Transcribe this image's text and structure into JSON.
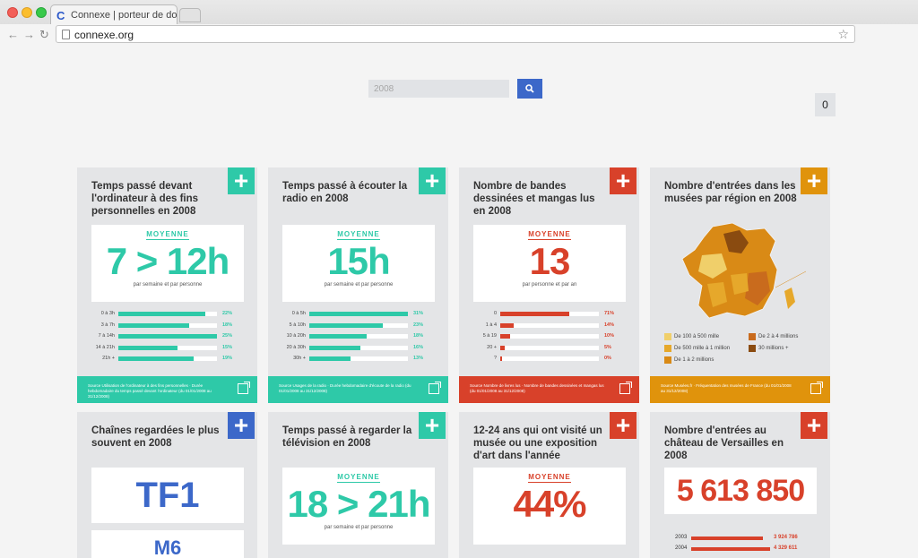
{
  "browser": {
    "tab_title": "Connexe | porteur de don",
    "tab_icon": "C",
    "url": "connexe.org"
  },
  "search": {
    "value": "2008"
  },
  "counter": "0",
  "colors": {
    "teal": "#2ec9a8",
    "red": "#d8412a",
    "blue": "#3c68c9",
    "orange": "#e0930c"
  },
  "cards": {
    "computer": {
      "title": "Temps passé devant l'ordinateur à des fins personnelles en 2008",
      "moyenne": "MOYENNE",
      "big": "7 > 12h",
      "unit": "par semaine et par personne",
      "rows": [
        {
          "label": "0 à 3h",
          "pct": "22%",
          "value": 22
        },
        {
          "label": "3 à 7h",
          "pct": "18%",
          "value": 18
        },
        {
          "label": "7 à 14h",
          "pct": "25%",
          "value": 25
        },
        {
          "label": "14 à 21h",
          "pct": "15%",
          "value": 15
        },
        {
          "label": "21h +",
          "pct": "19%",
          "value": 19
        }
      ],
      "source": "Source Utilisation de l'ordinateur à des fins personnelles · Durée hebdomadaire du temps passé devant l'ordinateur (du 01/01/2008 au 31/12/2008)"
    },
    "radio": {
      "title": "Temps passé à écouter la radio en 2008",
      "moyenne": "MOYENNE",
      "big": "15h",
      "unit": "par semaine et par personne",
      "rows": [
        {
          "label": "0 à 5h",
          "pct": "31%",
          "value": 31
        },
        {
          "label": "5 à 10h",
          "pct": "23%",
          "value": 23
        },
        {
          "label": "10 à 20h",
          "pct": "18%",
          "value": 18
        },
        {
          "label": "20 à 30h",
          "pct": "16%",
          "value": 16
        },
        {
          "label": "30h +",
          "pct": "13%",
          "value": 13
        }
      ],
      "source": "Source Usages de la radio · Durée hebdomadaire d'écoute de la radio (du 01/01/2008 au 31/12/2008)"
    },
    "bd": {
      "title": "Nombre de bandes dessinées et mangas lus en 2008",
      "moyenne": "MOYENNE",
      "big": "13",
      "unit": "par personne et par an",
      "rows": [
        {
          "label": "0",
          "pct": "71%",
          "value": 71
        },
        {
          "label": "1 à 4",
          "pct": "14%",
          "value": 14
        },
        {
          "label": "5 à 19",
          "pct": "10%",
          "value": 10
        },
        {
          "label": "20 +",
          "pct": "5%",
          "value": 5
        },
        {
          "label": "?",
          "pct": "0%",
          "value": 0
        }
      ],
      "source": "Source Nombre de livres lus · Nombre de bandes dessinées et mangas lus (du 01/01/2008 au 31/12/2008)"
    },
    "museums": {
      "title": "Nombre d'entrées dans les musées par région en 2008",
      "legend": [
        {
          "label": "De 100 à 500 mille",
          "color": "#f0cf6a"
        },
        {
          "label": "De 2 à 4 millions",
          "color": "#c96b1d"
        },
        {
          "label": "De 500 mille à 1 million",
          "color": "#e6a82b"
        },
        {
          "label": "30 millions +",
          "color": "#8a4b10"
        },
        {
          "label": "De 1 à 2 millions",
          "color": "#d98a16"
        }
      ],
      "source": "Source Musées.fr · Fréquentation des musées de France (du 01/01/2008 au 31/12/2008)"
    },
    "channels": {
      "title": "Chaînes regardées le plus souvent en 2008",
      "first": "TF1",
      "second": "M6"
    },
    "tv": {
      "title": "Temps passé à regarder la télévision en 2008",
      "moyenne": "MOYENNE",
      "big": "18 > 21h",
      "unit": "par semaine et par personne"
    },
    "youth": {
      "title": "12-24 ans qui ont visité un musée ou une exposition d'art dans l'année",
      "moyenne": "MOYENNE",
      "big": "44%"
    },
    "versailles": {
      "title": "Nombre d'entrées au château de Versailles en 2008",
      "big": "5 613 850",
      "years": [
        {
          "year": "2003",
          "display": "3 924 786",
          "value": 3924786
        },
        {
          "year": "2004",
          "display": "4 329 611",
          "value": 4329611
        }
      ]
    }
  }
}
